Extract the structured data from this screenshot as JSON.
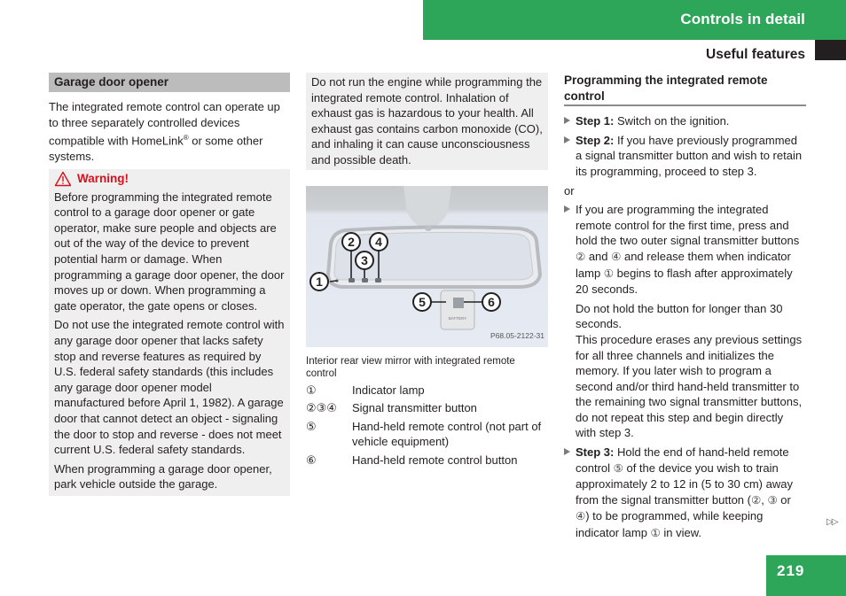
{
  "header": {
    "title": "Controls in detail",
    "subtitle": "Useful features",
    "accent_color": "#2ea65a"
  },
  "col1": {
    "section_title": "Garage door opener",
    "intro_pre": "The integrated remote control can operate up to three separately controlled devices compatible with HomeLink",
    "intro_sup": "®",
    "intro_post": " or some other systems.",
    "warning": {
      "icon": "warning-triangle-icon",
      "title": "Warning!",
      "paragraphs": [
        "Before programming the integrated remote control to a garage door opener or gate operator, make sure people and objects are out of the way of the device to prevent potential harm or damage. When programming a garage door opener, the door moves up or down. When programming a gate operator, the gate opens or closes.",
        "Do not use the integrated remote control with any garage door opener that lacks safety stop and reverse features as required by U.S. federal safety standards (this includes any garage door opener model manufactured before April 1, 1982). A garage door that cannot detect an object - signaling the door to stop and reverse - does not meet current U.S. federal safety standards.",
        "When programming a garage door opener, park vehicle outside the garage."
      ]
    }
  },
  "col2": {
    "warning_cont": "Do not run the engine while programming the integrated remote control. Inhalation of exhaust gas is hazardous to your health. All exhaust gas contains carbon monoxide (CO), and inhaling it can cause unconsciousness and possible death.",
    "figure": {
      "code": "P68.05-2122-31",
      "callouts": [
        "1",
        "2",
        "3",
        "4",
        "5",
        "6"
      ],
      "remote_label": "BATTERY"
    },
    "caption": "Interior rear view mirror with integrated remote control",
    "legend": [
      {
        "num": "①",
        "text": "Indicator lamp"
      },
      {
        "num": "②③④",
        "text": "Signal transmitter button"
      },
      {
        "num": "⑤",
        "text": "Hand-held remote control (not part of vehicle equipment)"
      },
      {
        "num": "⑥",
        "text": "Hand-held remote control button"
      }
    ]
  },
  "col3": {
    "title": "Programming the integrated remote control",
    "step1_label": "Step 1:",
    "step1_text": " Switch on the ignition.",
    "step2_label": "Step 2:",
    "step2_text": " If you have previously programmed a signal transmitter button and wish to retain its programming, proceed to step 3.",
    "or": "or",
    "alt_a": "If you are programming the integrated remote control for the first time, press and hold the two outer signal transmitter buttons ",
    "alt_c1": "②",
    "alt_b": " and ",
    "alt_c2": "④",
    "alt_c": " and release them when indicator lamp ",
    "alt_c3": "①",
    "alt_d": " begins to flash after approximately 20 seconds.",
    "note1": "Do not hold the button for longer than 30 seconds.",
    "note2": "This procedure erases any previous settings for all three channels and initializes the memory. If you later wish to program a second and/or third hand-held transmitter to the remaining two signal transmitter buttons, do not repeat this step and begin directly with step 3.",
    "step3_label": "Step 3:",
    "step3_a": " Hold the end of hand-held remote control ",
    "step3_c5": "⑤",
    "step3_b": " of the device you wish to train approximately 2 to 12 in (5 to 30 cm) away from the signal transmitter button (",
    "step3_c2": "②",
    "step3_sep": ", ",
    "step3_c3": "③",
    "step3_or": " or ",
    "step3_c4": "④",
    "step3_c": ") to be programmed, while keeping indicator lamp ",
    "step3_c1": "①",
    "step3_d": " in view."
  },
  "footer": {
    "continue_marker": "▷▷",
    "page_number": "219"
  }
}
